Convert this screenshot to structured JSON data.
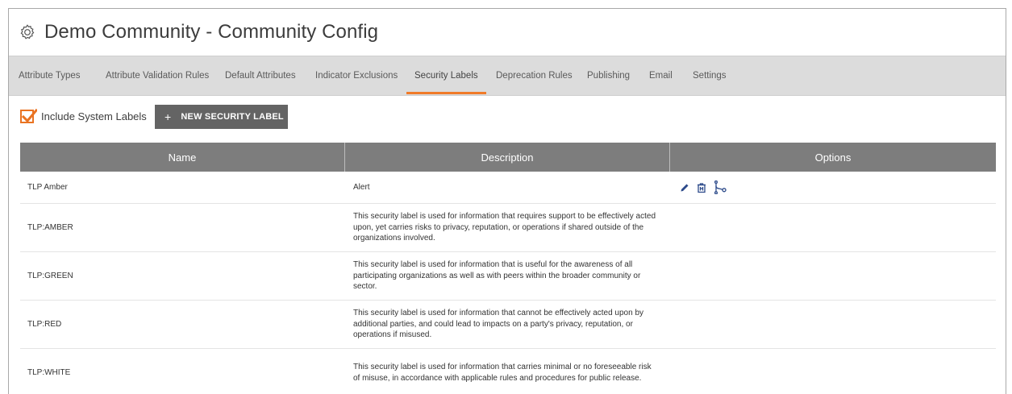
{
  "header": {
    "title": "Demo Community - Community Config",
    "icon": "gear-icon"
  },
  "tabs": [
    {
      "label": "Attribute Types",
      "active": false
    },
    {
      "label": "Attribute Validation Rules",
      "active": false
    },
    {
      "label": "Default Attributes",
      "active": false
    },
    {
      "label": "Indicator Exclusions",
      "active": false
    },
    {
      "label": "Security Labels",
      "active": true
    },
    {
      "label": "Deprecation Rules",
      "active": false
    },
    {
      "label": "Publishing",
      "active": false
    },
    {
      "label": "Email",
      "active": false
    },
    {
      "label": "Settings",
      "active": false
    }
  ],
  "toolbar": {
    "include_system_labels": "Include System Labels",
    "include_system_checked": true,
    "new_button": "NEW SECURITY LABEL",
    "new_button_icon": "plus-icon"
  },
  "table": {
    "columns": [
      "Name",
      "Description",
      "Options"
    ],
    "rows": [
      {
        "name": "TLP Amber",
        "description": "Alert",
        "options": [
          "edit-icon",
          "delete-icon",
          "fork-icon"
        ]
      },
      {
        "name": "TLP:AMBER",
        "description": "This security label is used for information that requires support to be effectively acted upon, yet carries risks to privacy, reputation, or operations if shared outside of the organizations involved."
      },
      {
        "name": "TLP:GREEN",
        "description": "This security label is used for information that is useful for the awareness of all participating organizations as well as with peers within the broader community or sector."
      },
      {
        "name": "TLP:RED",
        "description": "This security label is used for information that cannot be effectively acted upon by additional parties, and could lead to impacts on a party's privacy, reputation, or operations if misused."
      },
      {
        "name": "TLP:WHITE",
        "description": "This security label is used for information that carries minimal or no foreseeable risk of misuse, in accordance with applicable rules and procedures for public release."
      }
    ]
  },
  "colors": {
    "accent": "#f07b29",
    "icon_blue": "#2c4a8a",
    "header_bg": "#7d7d7d",
    "tabbar_bg": "#dcdcdc",
    "button_bg": "#646464"
  }
}
